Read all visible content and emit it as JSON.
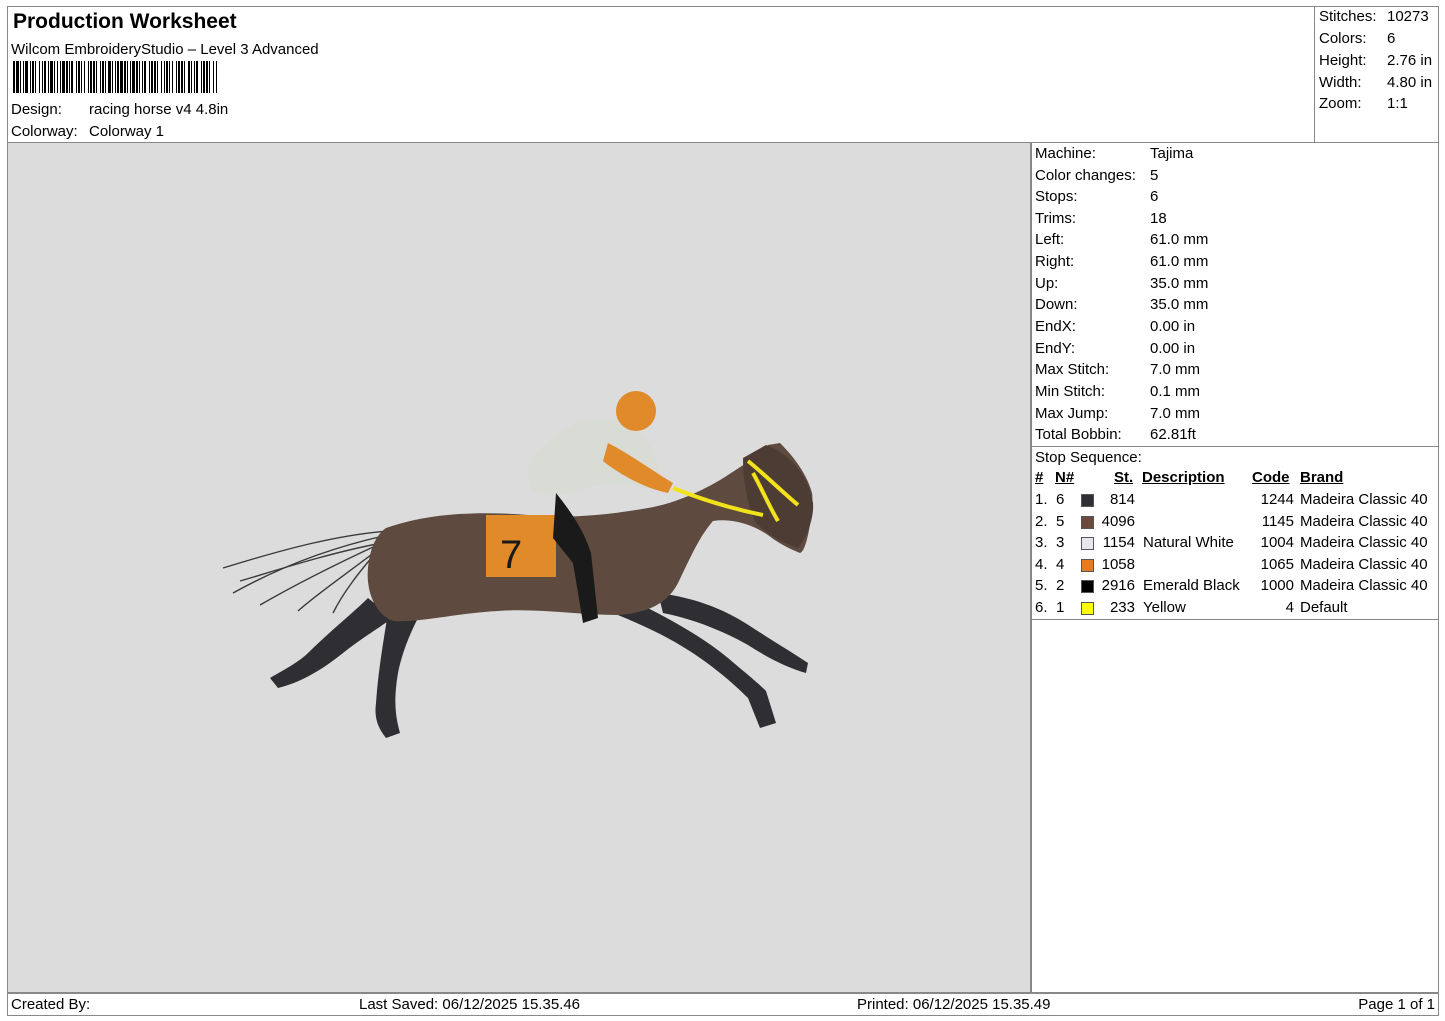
{
  "header": {
    "title": "Production Worksheet",
    "subtitle": "Wilcom EmbroideryStudio – Level 3 Advanced",
    "design_label": "Design:",
    "design_value": "racing horse v4 4.8in",
    "colorway_label": "Colorway:",
    "colorway_value": "Colorway 1"
  },
  "stats": [
    {
      "label": "Stitches:",
      "value": "10273"
    },
    {
      "label": "Colors:",
      "value": "6"
    },
    {
      "label": "Height:",
      "value": "2.76 in"
    },
    {
      "label": "Width:",
      "value": "4.80 in"
    },
    {
      "label": "Zoom:",
      "value": "1:1"
    }
  ],
  "machine": [
    {
      "label": "Machine:",
      "value": "Tajima"
    },
    {
      "label": "Color changes:",
      "value": "5"
    },
    {
      "label": "Stops:",
      "value": "6"
    },
    {
      "label": "Trims:",
      "value": "18"
    },
    {
      "label": "Left:",
      "value": "61.0 mm"
    },
    {
      "label": "Right:",
      "value": "61.0 mm"
    },
    {
      "label": "Up:",
      "value": "35.0 mm"
    },
    {
      "label": "Down:",
      "value": "35.0 mm"
    },
    {
      "label": "EndX:",
      "value": "0.00 in"
    },
    {
      "label": "EndY:",
      "value": "0.00 in"
    },
    {
      "label": "Max Stitch:",
      "value": "7.0 mm"
    },
    {
      "label": "Min Stitch:",
      "value": "0.1 mm"
    },
    {
      "label": "Max Jump:",
      "value": "7.0 mm"
    },
    {
      "label": "Total Bobbin:",
      "value": "62.81ft"
    }
  ],
  "stop_sequence": {
    "title": "Stop Sequence:",
    "headers": {
      "num": "#",
      "n": "N#",
      "st": "St.",
      "description": "Description",
      "code": "Code",
      "brand": "Brand"
    },
    "rows": [
      {
        "num": "1.",
        "n": "6",
        "color": "#2f2f37",
        "st": "814",
        "description": "",
        "code": "1244",
        "brand": "Madeira Classic 40"
      },
      {
        "num": "2.",
        "n": "5",
        "color": "#6b4a3e",
        "st": "4096",
        "description": "",
        "code": "1145",
        "brand": "Madeira Classic 40"
      },
      {
        "num": "3.",
        "n": "3",
        "color": "#e6e6ee",
        "st": "1154",
        "description": "Natural White",
        "code": "1004",
        "brand": "Madeira Classic 40"
      },
      {
        "num": "4.",
        "n": "4",
        "color": "#e87b1e",
        "st": "1058",
        "description": "",
        "code": "1065",
        "brand": "Madeira Classic 40"
      },
      {
        "num": "5.",
        "n": "2",
        "color": "#000000",
        "st": "2916",
        "description": "Emerald Black",
        "code": "1000",
        "brand": "Madeira Classic 40"
      },
      {
        "num": "6.",
        "n": "1",
        "color": "#ffff00",
        "st": "233",
        "description": "Yellow",
        "code": "4",
        "brand": "Default"
      }
    ]
  },
  "footer": {
    "created_by": "Created By:",
    "last_saved": "Last Saved: 06/12/2025 15.35.46",
    "printed": "Printed: 06/12/2025 15.35.49",
    "page": "Page 1 of 1"
  },
  "design_preview": {
    "jockey_number": "7",
    "colors": {
      "background": "#dcdcdc",
      "horse": "#5e4a3f",
      "legs": "#2f2f33",
      "silks": "#d8dcd4",
      "accent": "#e08a2a",
      "boots": "#1a1a1a",
      "bridle": "#f2e21a"
    }
  }
}
